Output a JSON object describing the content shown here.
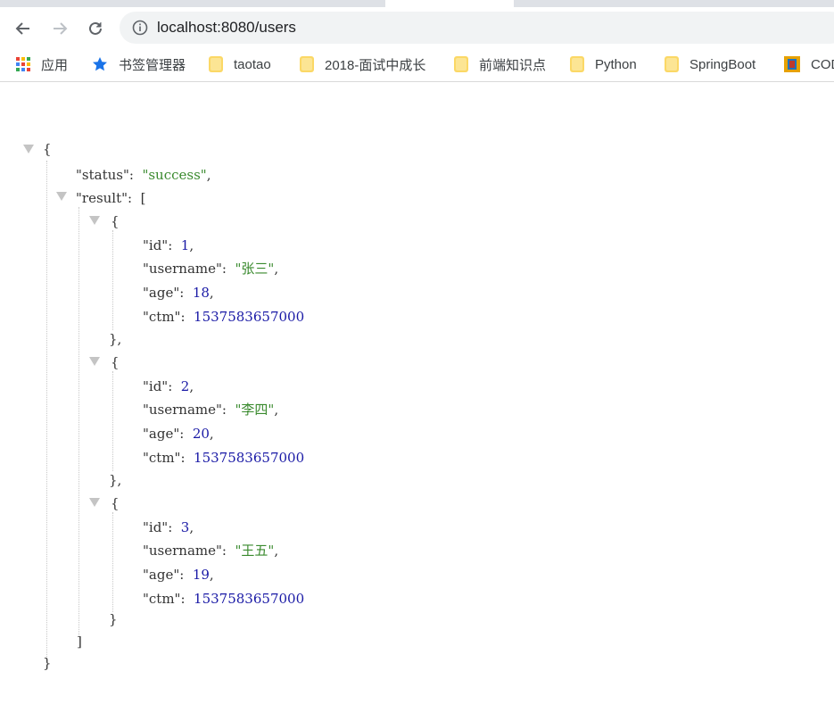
{
  "browser": {
    "url": "localhost:8080/users",
    "bookmarks": [
      {
        "label": "应用",
        "icon": "apps-grid-icon"
      },
      {
        "label": "书签管理器",
        "icon": "star-icon"
      },
      {
        "label": "taotao",
        "icon": "folder-icon"
      },
      {
        "label": "2018-面试中成长",
        "icon": "folder-icon"
      },
      {
        "label": "前端知识点",
        "icon": "folder-icon"
      },
      {
        "label": "Python",
        "icon": "folder-icon"
      },
      {
        "label": "SpringBoot",
        "icon": "folder-icon"
      },
      {
        "label": "COD",
        "icon": "code-icon"
      }
    ]
  },
  "json": {
    "brace_open": "{",
    "brace_close": "}",
    "status_key": "\"status\"",
    "status_value": "\"success\"",
    "result_key": "\"result\"",
    "bracket_open": "[",
    "bracket_close": "]",
    "id_key": "\"id\"",
    "username_key": "\"username\"",
    "age_key": "\"age\"",
    "ctm_key": "\"ctm\"",
    "users": [
      {
        "id": "1",
        "username": "\"张三\"",
        "age": "18",
        "ctm": "1537583657000"
      },
      {
        "id": "2",
        "username": "\"李四\"",
        "age": "20",
        "ctm": "1537583657000"
      },
      {
        "id": "3",
        "username": "\"王五\"",
        "age": "19",
        "ctm": "1537583657000"
      }
    ]
  },
  "colors": {
    "string": "#3a8a2e",
    "number": "#1a1aa6",
    "key": "#333333"
  }
}
